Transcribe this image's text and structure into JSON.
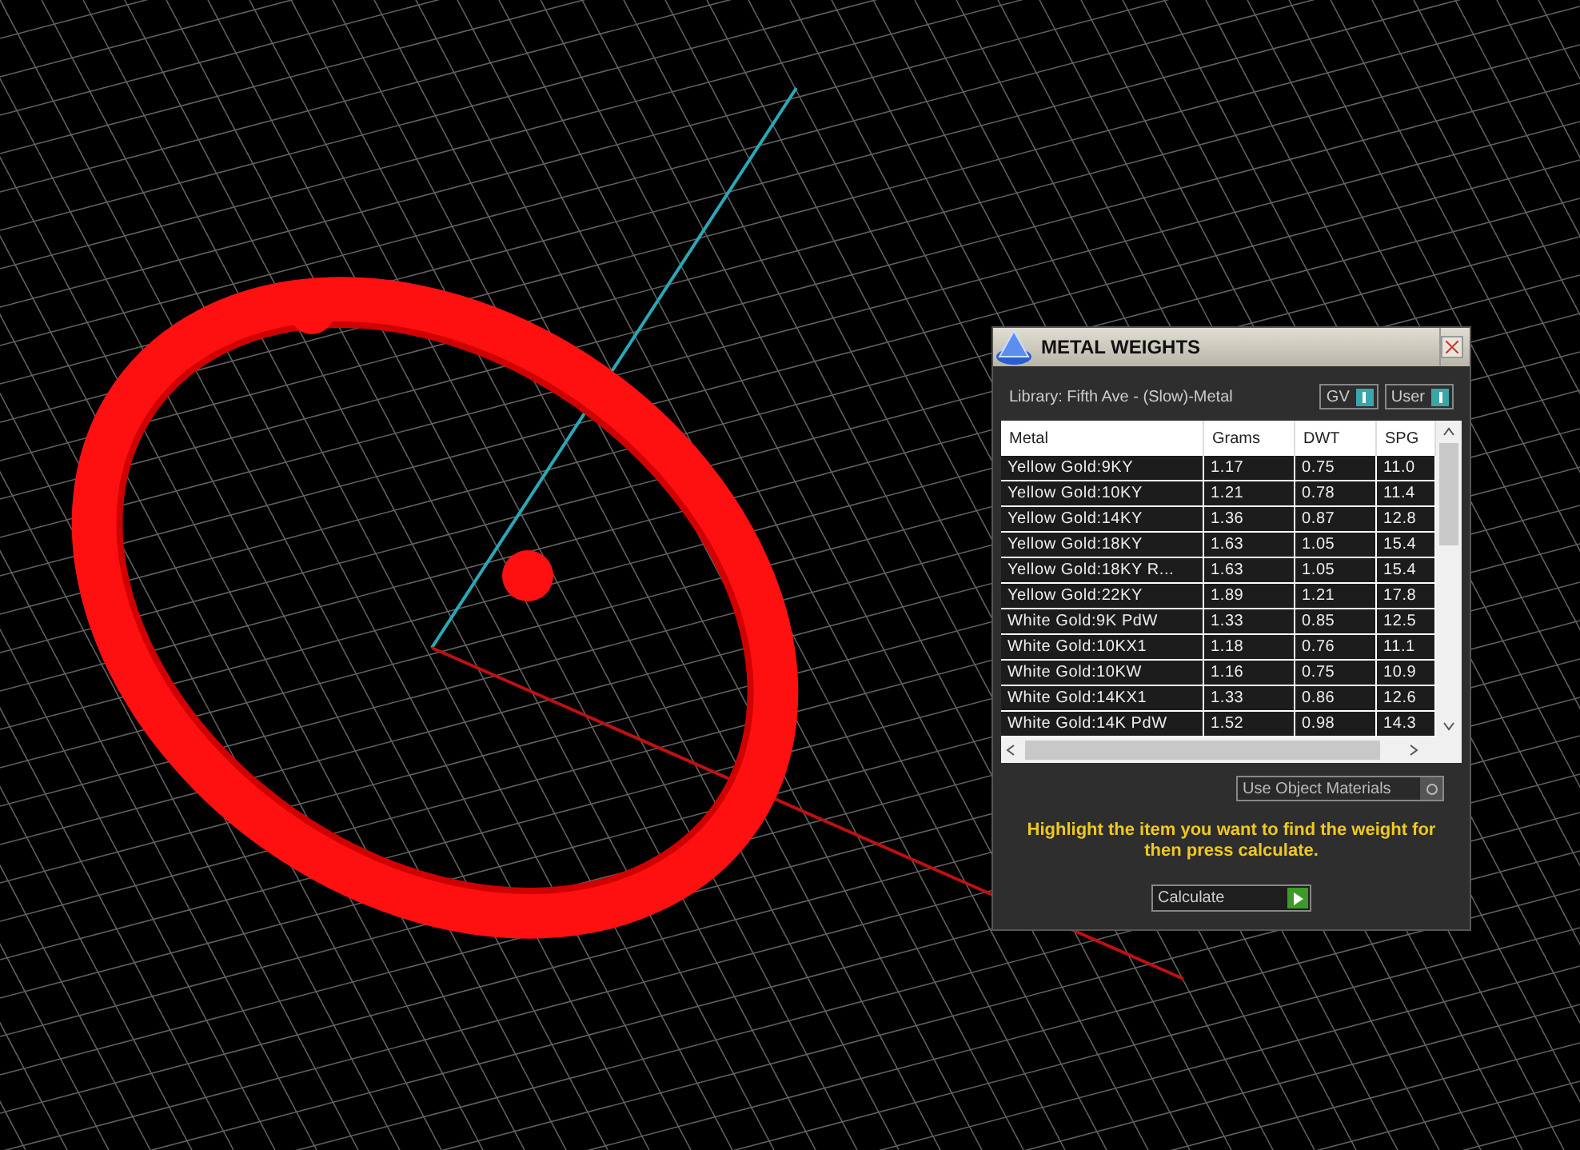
{
  "panel": {
    "title": "METAL WEIGHTS",
    "library": "Library: Fifth Ave - (Slow)-Metal",
    "toggles": [
      {
        "label": "GV",
        "on": true
      },
      {
        "label": "User",
        "on": true
      }
    ],
    "table": {
      "columns": [
        "Metal",
        "Grams",
        "DWT",
        "SPG"
      ],
      "rows": [
        {
          "cells": [
            "Yellow Gold:9KY",
            "1.17",
            "0.75",
            "11.0"
          ]
        },
        {
          "cells": [
            "Yellow Gold:10KY",
            "1.21",
            "0.78",
            "11.4"
          ]
        },
        {
          "cells": [
            "Yellow Gold:14KY",
            "1.36",
            "0.87",
            "12.8"
          ]
        },
        {
          "cells": [
            "Yellow Gold:18KY",
            "1.63",
            "1.05",
            "15.4"
          ]
        },
        {
          "cells": [
            "Yellow Gold:18KY R...",
            "1.63",
            "1.05",
            "15.4"
          ]
        },
        {
          "cells": [
            "Yellow Gold:22KY",
            "1.89",
            "1.21",
            "17.8"
          ]
        },
        {
          "cells": [
            "White Gold:9K PdW",
            "1.33",
            "0.85",
            "12.5"
          ]
        },
        {
          "cells": [
            "White Gold:10KX1",
            "1.18",
            "0.76",
            "11.1"
          ]
        },
        {
          "cells": [
            "White Gold:10KW",
            "1.16",
            "0.75",
            "10.9"
          ]
        },
        {
          "cells": [
            "White Gold:14KX1",
            "1.33",
            "0.86",
            "12.6"
          ]
        },
        {
          "cells": [
            "White Gold:14K PdW",
            "1.52",
            "0.98",
            "14.3"
          ]
        }
      ]
    },
    "use_object_materials": {
      "label": "Use Object Materials",
      "checked": false
    },
    "hint": "Highlight the item you want to find the weight for then press calculate.",
    "calculate_button": "Calculate"
  }
}
